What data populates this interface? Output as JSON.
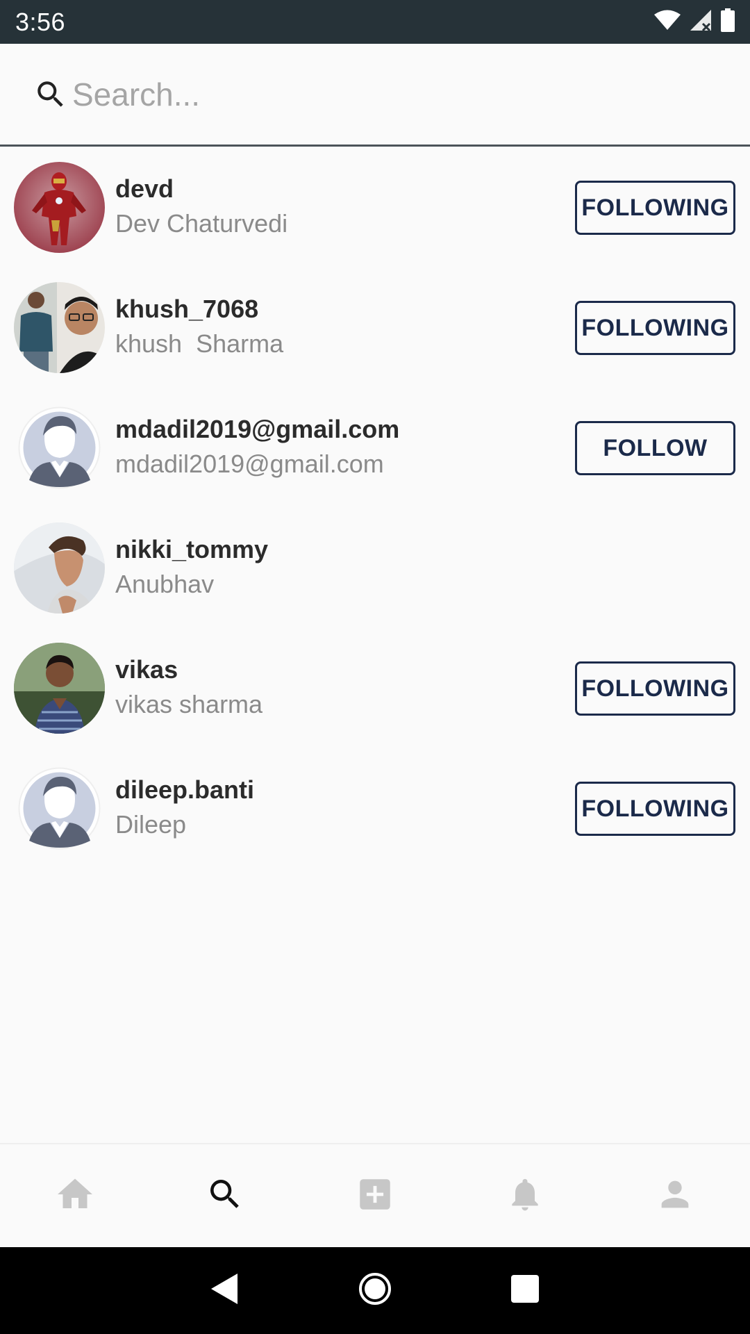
{
  "status_bar": {
    "time": "3:56"
  },
  "search": {
    "placeholder": "Search..."
  },
  "users": [
    {
      "username": "devd",
      "fullname": "Dev Chaturvedi",
      "button": "FOLLOWING"
    },
    {
      "username": "khush_7068",
      "fullname": "khush  Sharma",
      "button": "FOLLOWING"
    },
    {
      "username": "mdadil2019@gmail.com",
      "fullname": "mdadil2019@gmail.com",
      "button": "FOLLOW"
    },
    {
      "username": "nikki_tommy",
      "fullname": "Anubhav",
      "button": ""
    },
    {
      "username": "vikas",
      "fullname": "vikas sharma",
      "button": "FOLLOWING"
    },
    {
      "username": "dileep.banti",
      "fullname": "Dileep",
      "button": "FOLLOWING"
    }
  ],
  "bottom_nav": {
    "items": [
      "home-icon",
      "search-icon",
      "add-box-icon",
      "bell-icon",
      "person-icon"
    ],
    "active": "search-icon"
  },
  "colors": {
    "status_bar": "#263238",
    "button_border": "#1b2a4a",
    "inactive_nav": "#c7c7c7"
  }
}
